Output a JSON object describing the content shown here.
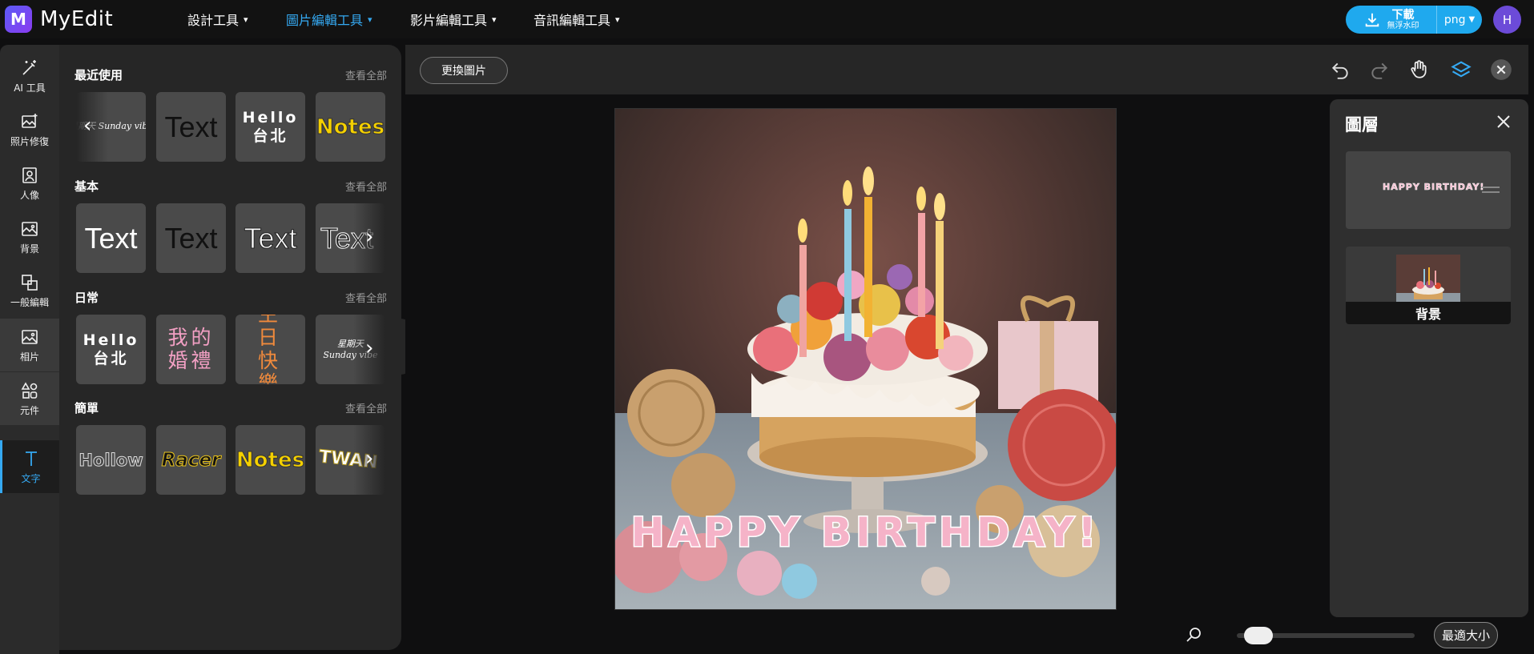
{
  "app": {
    "name": "MyEdit",
    "logo_letter": "M"
  },
  "top_nav": [
    {
      "label": "設計工具",
      "active": false
    },
    {
      "label": "圖片編輯工具",
      "active": true
    },
    {
      "label": "影片編輯工具",
      "active": false
    },
    {
      "label": "音訊編輯工具",
      "active": false
    }
  ],
  "download": {
    "label": "下載",
    "sublabel": "無浮水印",
    "format": "png"
  },
  "user": {
    "initial": "H"
  },
  "sidebar": [
    {
      "label": "AI 工具",
      "icon": "magic-wand-icon"
    },
    {
      "label": "照片修復",
      "icon": "photo-repair-icon"
    },
    {
      "label": "人像",
      "icon": "portrait-icon"
    },
    {
      "label": "背景",
      "icon": "background-icon"
    },
    {
      "label": "一般編輯",
      "icon": "crop-edit-icon"
    },
    {
      "label": "相片",
      "icon": "photo-icon"
    },
    {
      "label": "元件",
      "icon": "shapes-icon"
    },
    {
      "label": "文字",
      "icon": "text-icon"
    }
  ],
  "panel": {
    "view_all": "查看全部",
    "sections": [
      {
        "title": "最近使用",
        "tiles": [
          "星期天 Sunday vibe",
          "Text",
          "Hello 台北",
          "Notes"
        ]
      },
      {
        "title": "基本",
        "tiles": [
          "Text",
          "Text",
          "Text",
          "Text"
        ]
      },
      {
        "title": "日常",
        "tiles": [
          "Hello 台北",
          "我的婚禮",
          "生日快樂",
          "星期天 Sunday vibe"
        ]
      },
      {
        "title": "簡單",
        "tiles": [
          "Hollow",
          "Racer",
          "Notes",
          "TWAN"
        ]
      }
    ]
  },
  "toolbar": {
    "change_image": "更換圖片"
  },
  "canvas": {
    "text": "HAPPY BIRTHDAY!"
  },
  "layers": {
    "title": "圖層",
    "items": [
      {
        "label": "HAPPY BIRTHDAY!",
        "type": "text"
      },
      {
        "label": "背景",
        "type": "image"
      }
    ]
  },
  "zoom": {
    "fit_label": "最適大小",
    "level": 0.05
  },
  "colors": {
    "accent": "#1fa9ee",
    "active_nav": "#35a9f2",
    "avatar": "#6c4bd8"
  }
}
